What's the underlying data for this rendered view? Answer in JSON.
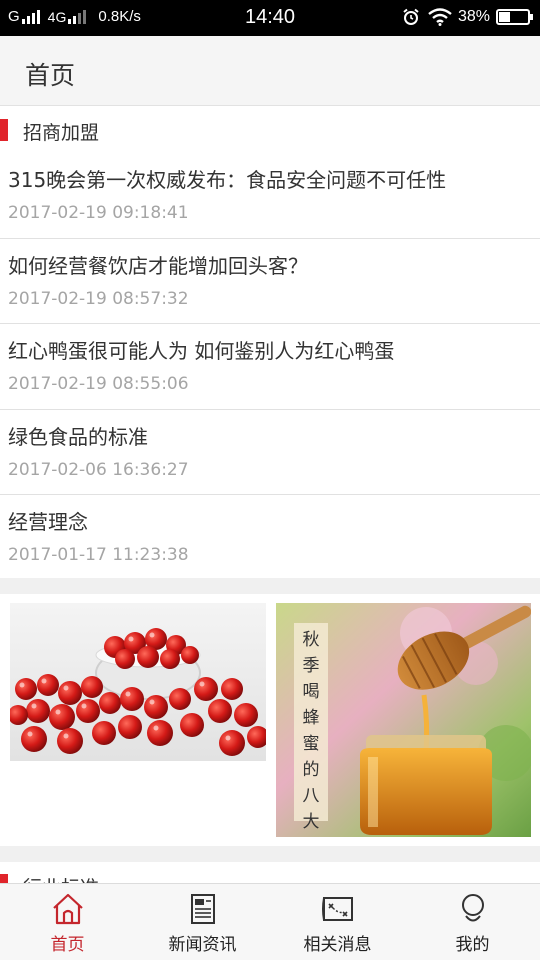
{
  "status_bar": {
    "carrier": "G",
    "network": "4G",
    "speed": "0.8K/s",
    "time": "14:40",
    "battery_pct": "38%",
    "battery_level": 0.38
  },
  "header": {
    "title": "首页"
  },
  "sections": {
    "franchise": {
      "label": "招商加盟"
    },
    "industry_standards": {
      "label": "行业标准"
    }
  },
  "news": [
    {
      "title": "315晚会第一次权威发布：食品安全问题不可任性",
      "date": "2017-02-19 09:18:41"
    },
    {
      "title": "如何经营餐饮店才能增加回头客？",
      "date": "2017-02-19 08:57:32"
    },
    {
      "title": "红心鸭蛋很可能人为 如何鉴别人为红心鸭蛋",
      "date": "2017-02-19 08:55:06"
    },
    {
      "title": "绿色食品的标准",
      "date": "2017-02-06 16:36:27"
    },
    {
      "title": "经营理念",
      "date": "2017-01-17 11:23:38"
    }
  ],
  "images": {
    "left": {
      "alt_icon": "hawthorn-photo"
    },
    "right": {
      "alt_icon": "honey-photo",
      "caption": "秋季喝蜂蜜的八大好处"
    }
  },
  "bottom_nav": [
    {
      "label": "首页",
      "icon": "home-icon",
      "active": true
    },
    {
      "label": "新闻资讯",
      "icon": "newspaper-icon",
      "active": false
    },
    {
      "label": "相关消息",
      "icon": "map-icon",
      "active": false
    },
    {
      "label": "我的",
      "icon": "user-icon",
      "active": false
    }
  ],
  "colors": {
    "accent": "#e0242b",
    "active_nav": "#c4262d",
    "date_text": "#a5a5a5",
    "gap": "#f0f0f0"
  }
}
